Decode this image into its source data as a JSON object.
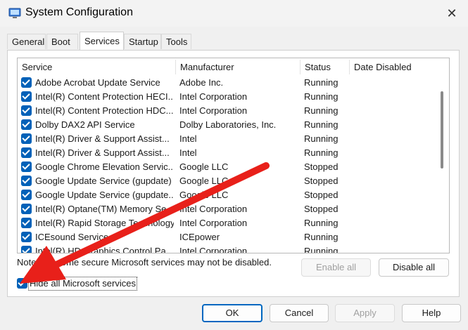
{
  "window": {
    "title": "System Configuration",
    "close_glyph": "✕"
  },
  "tabs": [
    {
      "label": "General",
      "active": false
    },
    {
      "label": "Boot",
      "active": false
    },
    {
      "label": "Services",
      "active": true
    },
    {
      "label": "Startup",
      "active": false
    },
    {
      "label": "Tools",
      "active": false
    }
  ],
  "services": {
    "columns": [
      "Service",
      "Manufacturer",
      "Status",
      "Date Disabled"
    ],
    "rows": [
      {
        "service": "Adobe Acrobat Update Service",
        "manufacturer": "Adobe Inc.",
        "status": "Running",
        "checked": true
      },
      {
        "service": "Intel(R) Content Protection HECI...",
        "manufacturer": "Intel Corporation",
        "status": "Running",
        "checked": true
      },
      {
        "service": "Intel(R) Content Protection HDC...",
        "manufacturer": "Intel Corporation",
        "status": "Running",
        "checked": true
      },
      {
        "service": "Dolby DAX2 API Service",
        "manufacturer": "Dolby Laboratories, Inc.",
        "status": "Running",
        "checked": true
      },
      {
        "service": "Intel(R) Driver & Support Assist...",
        "manufacturer": "Intel",
        "status": "Running",
        "checked": true
      },
      {
        "service": "Intel(R) Driver & Support Assist...",
        "manufacturer": "Intel",
        "status": "Running",
        "checked": true
      },
      {
        "service": "Google Chrome Elevation Servic...",
        "manufacturer": "Google LLC",
        "status": "Stopped",
        "checked": true
      },
      {
        "service": "Google Update Service (gupdate)",
        "manufacturer": "Google LLC",
        "status": "Stopped",
        "checked": true
      },
      {
        "service": "Google Update Service (gupdate...",
        "manufacturer": "Google LLC",
        "status": "Stopped",
        "checked": true
      },
      {
        "service": "Intel(R) Optane(TM) Memory Se...",
        "manufacturer": "Intel Corporation",
        "status": "Stopped",
        "checked": true
      },
      {
        "service": "Intel(R) Rapid Storage Technology",
        "manufacturer": "Intel Corporation",
        "status": "Running",
        "checked": true
      },
      {
        "service": "ICEsound Service",
        "manufacturer": "ICEpower",
        "status": "Running",
        "checked": true
      },
      {
        "service": "Intel(R) HD Graphics Control Pa...",
        "manufacturer": "Intel Corporation",
        "status": "Running",
        "checked": true
      }
    ]
  },
  "note": "Note that some secure Microsoft services may not be disabled.",
  "buttons": {
    "enable_all": "Enable all",
    "disable_all": "Disable all",
    "ok": "OK",
    "cancel": "Cancel",
    "apply": "Apply",
    "help": "Help"
  },
  "hide_ms": {
    "label": "Hide all Microsoft services",
    "checked": true
  },
  "colors": {
    "accent": "#0061b8",
    "arrow": "#e8201a"
  }
}
